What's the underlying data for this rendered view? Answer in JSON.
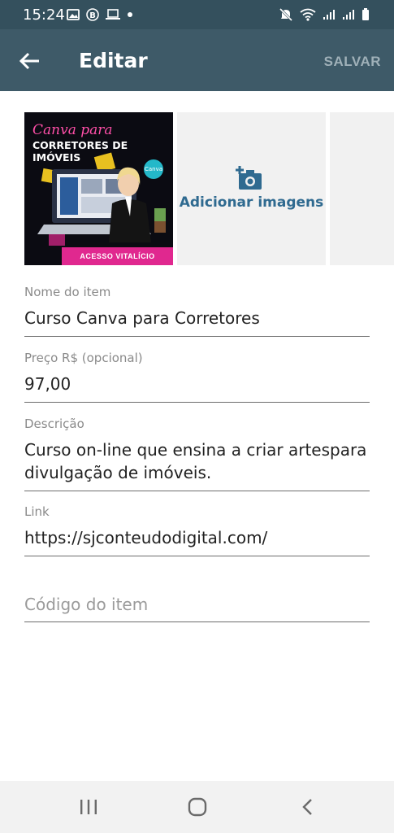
{
  "status_bar": {
    "time": "15:24",
    "left_icons": [
      "image-icon",
      "b-badge-icon",
      "laptop-icon",
      "dot-icon"
    ],
    "right_icons": [
      "mute-icon",
      "wifi-icon",
      "signal-icon",
      "signal-icon",
      "battery-icon"
    ]
  },
  "app_bar": {
    "title": "Editar",
    "save_label": "SALVAR"
  },
  "images": {
    "thumbnail": {
      "line1": "Canva para",
      "line2": "CORRETORES DE IMÓVEIS",
      "bottom_banner": "ACESSO VITALÍCIO",
      "badge": "Canva"
    },
    "add_label": "Adicionar imagens"
  },
  "form": {
    "name": {
      "label": "Nome do item",
      "value": "Curso Canva para Corretores"
    },
    "price": {
      "label": "Preço R$ (opcional)",
      "value": "97,00"
    },
    "description": {
      "label": "Descrição",
      "line1": "Curso on-line que ensina a criar artespara",
      "line2": "divulgação de imóveis."
    },
    "link": {
      "label": "Link",
      "value": "https://sjconteudodigital.com/"
    },
    "code": {
      "placeholder": "Código do item"
    }
  },
  "nav_bar": {
    "buttons": [
      "recent-apps-icon",
      "home-icon",
      "back-icon"
    ]
  },
  "colors": {
    "status_bar": "#34505d",
    "app_bar": "#3e5a68",
    "accent": "#2f6a90"
  }
}
